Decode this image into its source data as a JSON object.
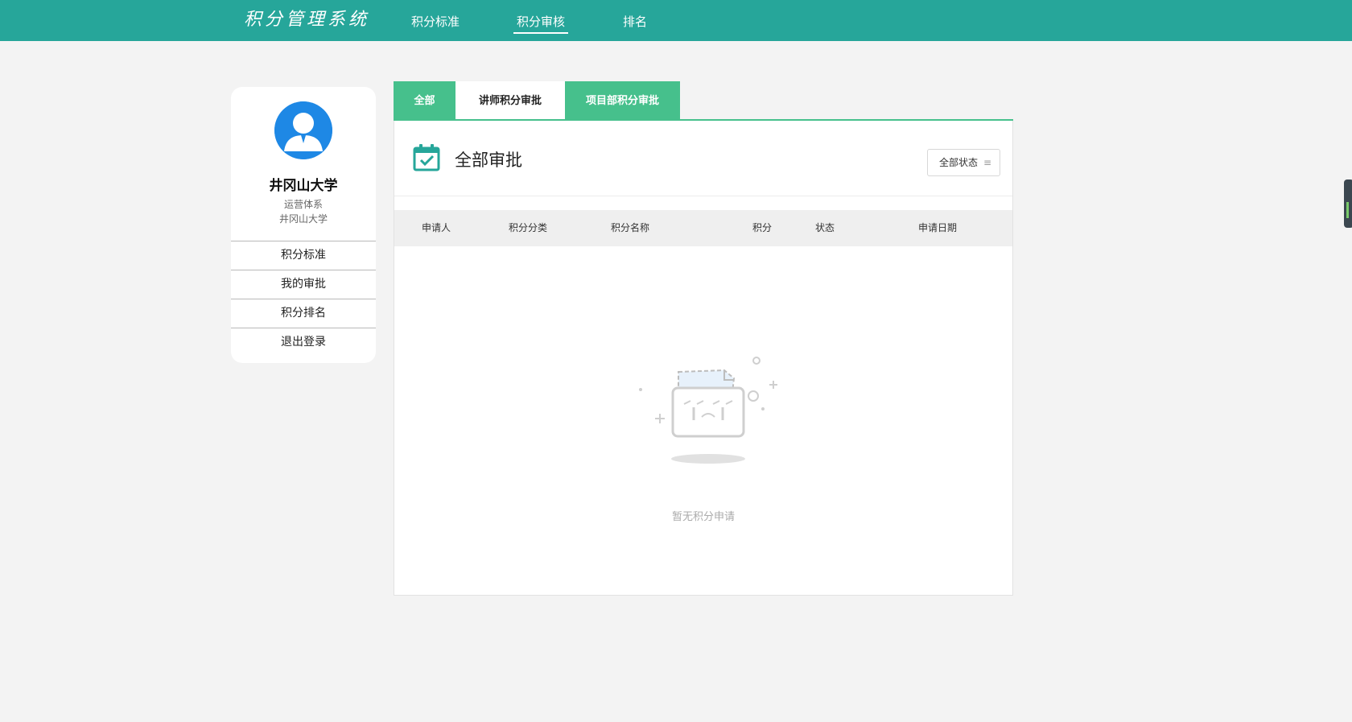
{
  "app": {
    "title": "积分管理系统",
    "accent_color": "#26a69a",
    "tab_color": "#46c08c"
  },
  "nav": {
    "items": [
      {
        "label": "积分标准"
      },
      {
        "label": "积分审核"
      },
      {
        "label": "排名"
      }
    ],
    "active": "积分审核"
  },
  "sidebar": {
    "org_name": "井冈山大学",
    "department": "运营体系",
    "org_sub": "井冈山大学",
    "menu": [
      {
        "label": "积分标准"
      },
      {
        "label": "我的审批"
      },
      {
        "label": "积分排名"
      },
      {
        "label": "退出登录"
      }
    ]
  },
  "tabs": {
    "items": [
      {
        "label": "全部"
      },
      {
        "label": "讲师积分审批"
      },
      {
        "label": "项目部积分审批"
      }
    ],
    "active": "讲师积分审批"
  },
  "panel": {
    "title": "全部审批",
    "status_filter": "全部状态",
    "table_headers": [
      "申请人",
      "积分分类",
      "积分名称",
      "积分",
      "状态",
      "申请日期"
    ],
    "rows": [],
    "empty_text": "暂无积分申请"
  },
  "icons": {
    "avatar": "user-avatar-icon",
    "calendar": "calendar-check-icon",
    "filter_menu": "menu-lines-icon",
    "empty": "empty-box-illustration"
  }
}
